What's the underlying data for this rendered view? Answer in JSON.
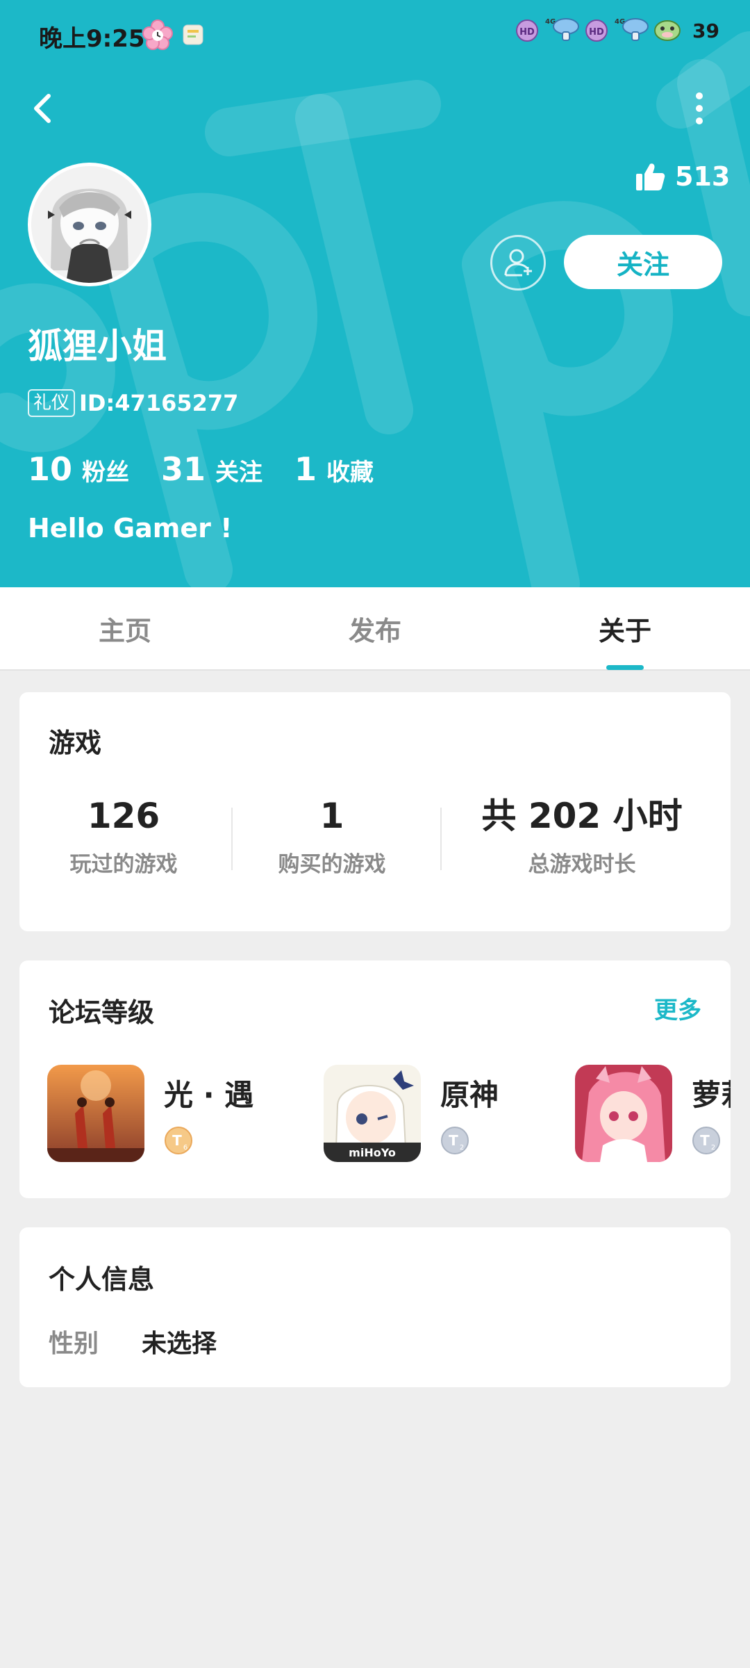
{
  "status_bar": {
    "time": "晚上9:25",
    "battery": "39"
  },
  "colors": {
    "accent": "#1cb8c8",
    "header_bg": "#1cb8c8",
    "page_bg": "#eeeeee"
  },
  "profile": {
    "likes": "513",
    "follow_label": "关注",
    "username": "狐狸小姐",
    "badge": "礼仪",
    "user_id": "ID:47165277",
    "stats": [
      {
        "value": "10",
        "label": "粉丝"
      },
      {
        "value": "31",
        "label": "关注"
      },
      {
        "value": "1",
        "label": "收藏"
      }
    ],
    "bio": "Hello Gamer !"
  },
  "tabs": [
    {
      "label": "主页",
      "active": false
    },
    {
      "label": "发布",
      "active": false
    },
    {
      "label": "关于",
      "active": true
    }
  ],
  "games": {
    "title": "游戏",
    "stats": [
      {
        "value": "126",
        "label": "玩过的游戏"
      },
      {
        "value": "1",
        "label": "购买的游戏"
      },
      {
        "value": "共 202 小时",
        "label": "总游戏时长"
      }
    ]
  },
  "forum": {
    "title": "论坛等级",
    "more": "更多",
    "items": [
      {
        "name": "光 · 遇",
        "icon": "sky-game-icon",
        "level_icon": "gold-level-badge-icon"
      },
      {
        "name": "原神",
        "icon": "genshin-game-icon",
        "level_icon": "silver-level-badge-icon"
      },
      {
        "name": "萝莉",
        "icon": "anime-game-icon",
        "level_icon": "silver-level-badge-icon"
      }
    ]
  },
  "personal_info": {
    "title": "个人信息",
    "gender_label": "性别",
    "gender_value": "未选择"
  }
}
